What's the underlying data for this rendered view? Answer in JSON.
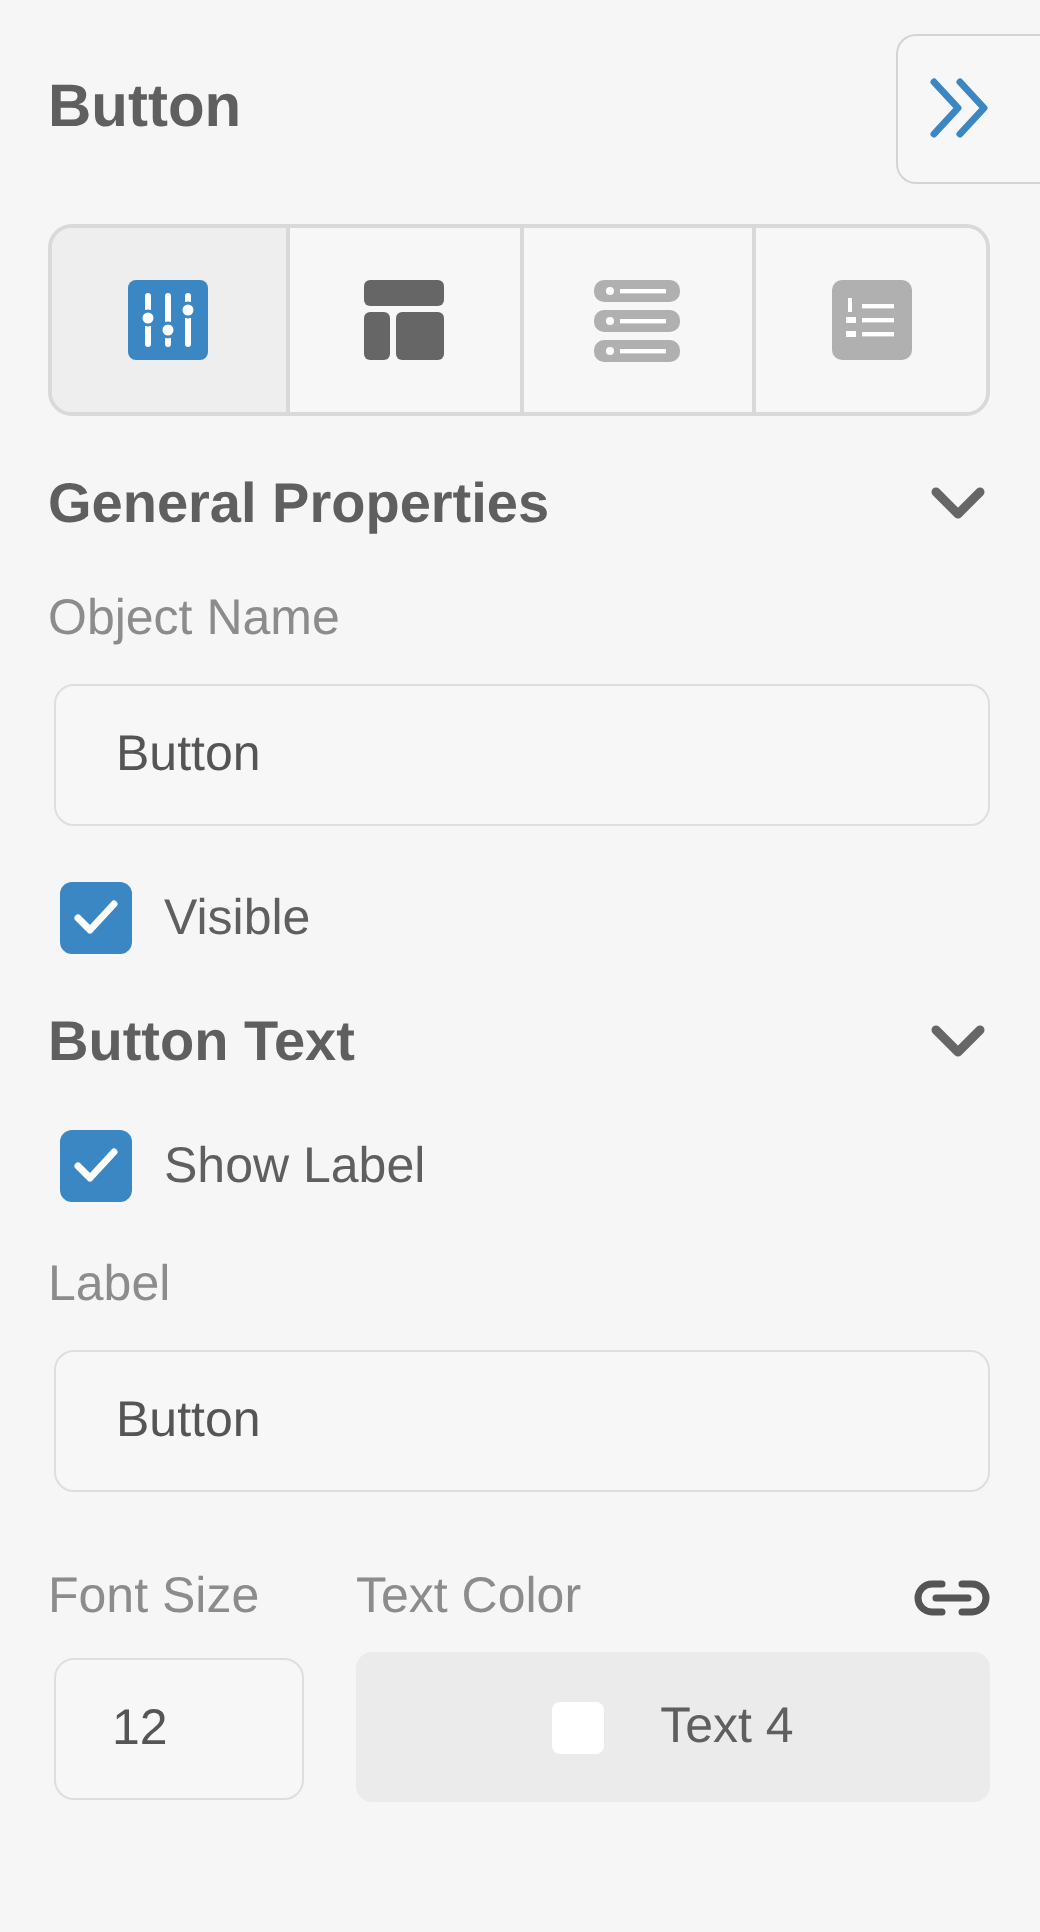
{
  "title": "Button",
  "tabs": [
    {
      "kind": "sliders",
      "selected": true,
      "disabled": false
    },
    {
      "kind": "layout",
      "selected": false,
      "disabled": false
    },
    {
      "kind": "list",
      "selected": false,
      "disabled": true
    },
    {
      "kind": "numbered",
      "selected": false,
      "disabled": true
    }
  ],
  "sections": [
    {
      "title": "General Properties",
      "expanded": true,
      "rows": [
        {
          "kind": "text",
          "label": "Object Name",
          "value": "Button"
        },
        {
          "kind": "checkbox",
          "label": "Visible",
          "checked": true
        }
      ]
    },
    {
      "title": "Button Text",
      "expanded": true,
      "rows": [
        {
          "kind": "checkbox",
          "label": "Show Label",
          "checked": true
        },
        {
          "kind": "text",
          "label": "Label",
          "value": "Button"
        },
        {
          "kind": "font",
          "size_label": "Font Size",
          "size": "12",
          "color_label": "Text Color",
          "color_name": "Text 4",
          "color": "#ffffff"
        }
      ]
    }
  ]
}
